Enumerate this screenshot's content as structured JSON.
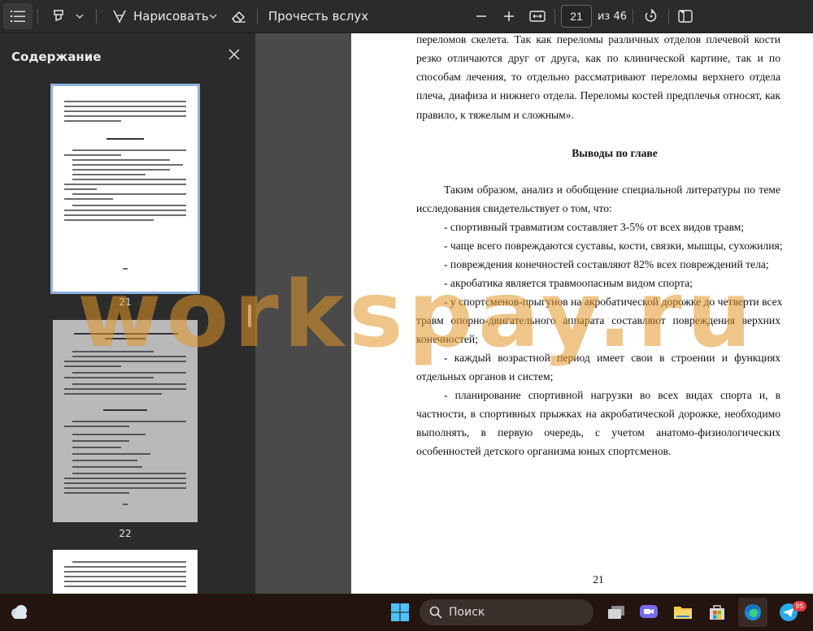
{
  "toolbar": {
    "draw_label": "Нарисовать",
    "read_aloud_label": "Прочесть вслух",
    "page_current": "21",
    "page_total": "из 46"
  },
  "sidebar": {
    "title": "Содержание",
    "thumbs": [
      {
        "num": "21"
      },
      {
        "num": "22"
      }
    ]
  },
  "document": {
    "lines": [
      "переломов скелета. Так как переломы различных отделов плечевой кости",
      "резко отличаются друг от друга, как по клинической картине, так и по",
      "способам лечения, то отдельно рассматривают переломы верхнего отдела",
      "плеча, диафиза и нижнего отдела. Переломы костей предплечья относят, как",
      "правило, к тяжелым и сложным»."
    ],
    "heading": "Выводы по главе",
    "body": [
      "Таким образом, анализ и обобщение специальной литературы по теме",
      "исследования свидетельствует о том, что:",
      "- спортивный травматизм составляет 3-5% от всех видов травм;",
      "- чаще всего повреждаются суставы, кости, связки, мышцы, сухожилия;",
      "- повреждения конечностей составляют 82% всех повреждений тела;",
      "- акробатика является травмоопасным видом спорта;",
      "- у спортсменов-прыгунов на акробатической дорожке до четверти всех",
      "травм опорно-двигательного аппарата составляют повреждения верхних",
      "конечностей;",
      "- каждый возрастной период имеет свои в строении и функциях",
      "отдельных органов и систем;",
      "- планирование спортивной нагрузки во всех видах спорта и, в",
      "частности, в спортивных прыжках на акробатической дорожке, необходимо",
      "выполнять, в первую очередь, с учетом анатомо-физиологических",
      "особенностей детского организма юных спортсменов."
    ],
    "page_number": "21"
  },
  "watermark": "workspay.ru",
  "taskbar": {
    "search_label": "Поиск",
    "telegram_badge": "95"
  }
}
